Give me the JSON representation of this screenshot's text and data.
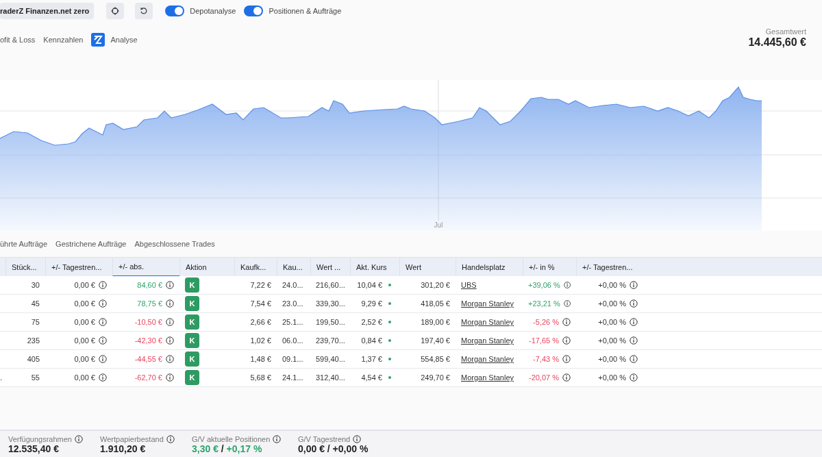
{
  "toolbar": {
    "account_button": "raderZ Finanzen.net zero",
    "toggles": [
      {
        "label": "Depotanalyse",
        "on": true
      },
      {
        "label": "Positionen & Aufträge",
        "on": true
      }
    ]
  },
  "view_tabs": [
    {
      "label": "ofit & Loss",
      "kind": "text"
    },
    {
      "label": "Kennzahlen",
      "kind": "text"
    },
    {
      "label": "Analyse",
      "kind": "logo"
    }
  ],
  "total": {
    "label": "Gesamtwert",
    "value": "14.445,60 €"
  },
  "chart": {
    "x_label": "Jul"
  },
  "order_tabs": [
    "ührte Aufträge",
    "Gestrichene Aufträge",
    "Abgeschlossene Trades"
  ],
  "table": {
    "columns": [
      {
        "label": "Stück...",
        "sorted": false
      },
      {
        "label": "+/- Tagestren...",
        "sorted": false
      },
      {
        "label": "+/- abs.",
        "sorted": true
      },
      {
        "label": "Aktion",
        "sorted": false
      },
      {
        "label": "Kaufk...",
        "sorted": false
      },
      {
        "label": "Kau...",
        "sorted": false
      },
      {
        "label": "Wert ...",
        "sorted": false
      },
      {
        "label": "Akt. Kurs",
        "sorted": false
      },
      {
        "label": "Wert",
        "sorted": false
      },
      {
        "label": "Handelsplatz",
        "sorted": false
      },
      {
        "label": "+/- in %",
        "sorted": false
      },
      {
        "label": "+/- Tagestren...",
        "sorted": false
      }
    ],
    "rows": [
      {
        "lead": "",
        "qty": "30",
        "day_abs": "0,00 €",
        "abs": "84,60 €",
        "abs_positive": true,
        "action": "K",
        "buy_price": "7,22 €",
        "buy_date": "24.0...",
        "buy_value": "216,60...",
        "price": "10,04 €",
        "value": "301,20 €",
        "venue": "UBS",
        "pct": "+39,06 %",
        "pct_positive": true,
        "day_pct": "+0,00 %"
      },
      {
        "lead": "",
        "qty": "45",
        "day_abs": "0,00 €",
        "abs": "78,75 €",
        "abs_positive": true,
        "action": "K",
        "buy_price": "7,54 €",
        "buy_date": "23.0...",
        "buy_value": "339,30...",
        "price": "9,29 €",
        "value": "418,05 €",
        "venue": "Morgan Stanley",
        "pct": "+23,21 %",
        "pct_positive": true,
        "day_pct": "+0,00 %"
      },
      {
        "lead": "",
        "qty": "75",
        "day_abs": "0,00 €",
        "abs": "-10,50 €",
        "abs_positive": false,
        "action": "K",
        "buy_price": "2,66 €",
        "buy_date": "25.1...",
        "buy_value": "199,50...",
        "price": "2,52 €",
        "value": "189,00 €",
        "venue": "Morgan Stanley",
        "pct": "-5,26 %",
        "pct_positive": false,
        "day_pct": "+0,00 %"
      },
      {
        "lead": "",
        "qty": "235",
        "day_abs": "0,00 €",
        "abs": "-42,30 €",
        "abs_positive": false,
        "action": "K",
        "buy_price": "1,02 €",
        "buy_date": "06.0...",
        "buy_value": "239,70...",
        "price": "0,84 €",
        "value": "197,40 €",
        "venue": "Morgan Stanley",
        "pct": "-17,65 %",
        "pct_positive": false,
        "day_pct": "+0,00 %"
      },
      {
        "lead": "",
        "qty": "405",
        "day_abs": "0,00 €",
        "abs": "-44,55 €",
        "abs_positive": false,
        "action": "K",
        "buy_price": "1,48 €",
        "buy_date": "09.1...",
        "buy_value": "599,40...",
        "price": "1,37 €",
        "value": "554,85 €",
        "venue": "Morgan Stanley",
        "pct": "-7,43 %",
        "pct_positive": false,
        "day_pct": "+0,00 %"
      },
      {
        "lead": ".",
        "qty": "55",
        "day_abs": "0,00 €",
        "abs": "-62,70 €",
        "abs_positive": false,
        "action": "K",
        "buy_price": "5,68 €",
        "buy_date": "24.1...",
        "buy_value": "312,40...",
        "price": "4,54 €",
        "value": "249,70 €",
        "venue": "Morgan Stanley",
        "pct": "-20,07 %",
        "pct_positive": false,
        "day_pct": "+0,00 %"
      }
    ]
  },
  "footer": [
    {
      "label": "Verfügungsrahmen",
      "value": "12.535,40 €",
      "kind": "plain"
    },
    {
      "label": "Wertpapierbestand",
      "value": "1.910,20 €",
      "kind": "plain"
    },
    {
      "label": "G/V aktuelle Positionen",
      "value": "3,30 €",
      "value_2": "+0,17 %",
      "separator": "/",
      "kind": "gain"
    },
    {
      "label": "G/V Tagestrend",
      "value": "0,00 €",
      "value_2": "+0,00 %",
      "separator": "/",
      "kind": "split"
    }
  ]
}
